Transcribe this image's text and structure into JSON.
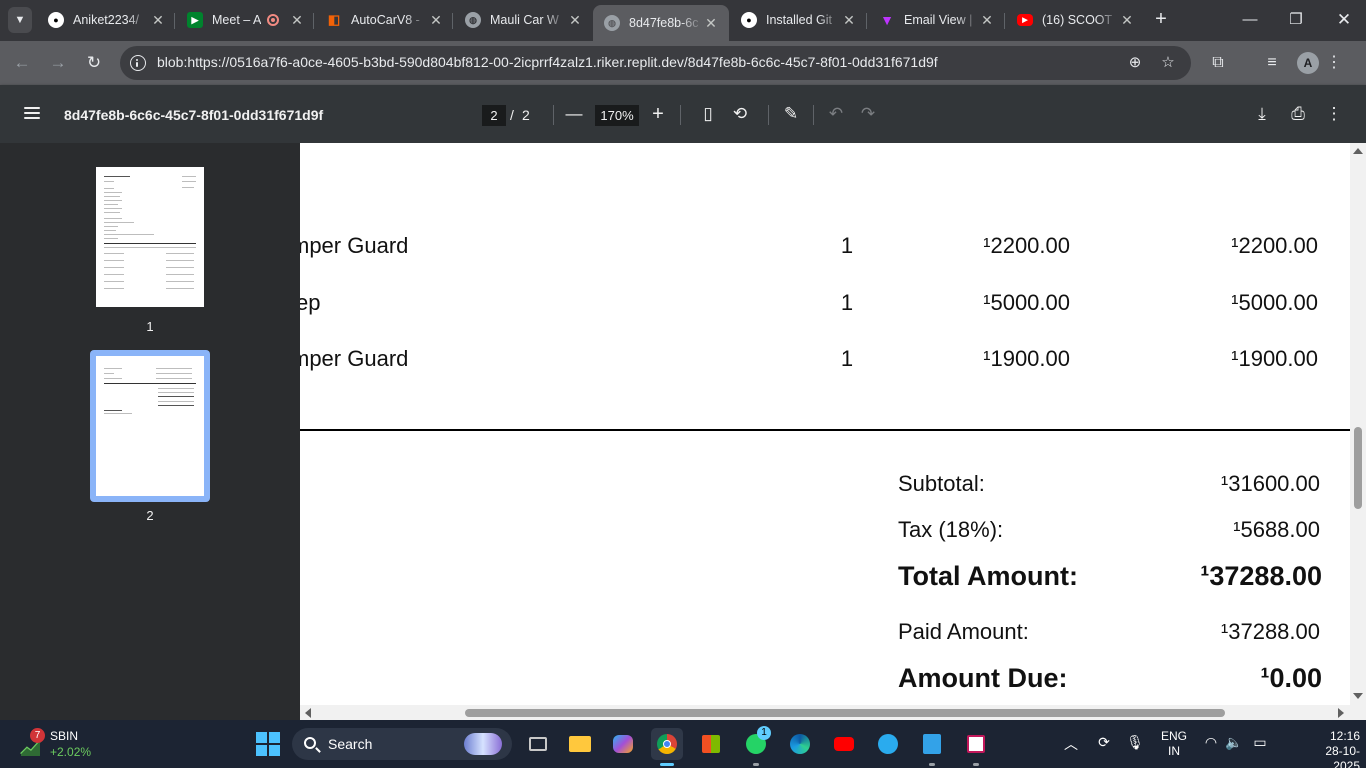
{
  "browser": {
    "tabs": [
      {
        "title": "Aniket2234/",
        "icon": "github-icon"
      },
      {
        "title": "Meet – A",
        "icon": "google-meet-icon"
      },
      {
        "title": "AutoCarV8 -",
        "icon": "replit-icon"
      },
      {
        "title": "Mauli Car W",
        "icon": "globe-icon"
      },
      {
        "title": "8d47fe8b-6c",
        "icon": "globe-icon",
        "active": true
      },
      {
        "title": "Installed Git",
        "icon": "github-icon"
      },
      {
        "title": "Email View |",
        "icon": "vite-icon"
      },
      {
        "title": "(16) SCOOT",
        "icon": "youtube-icon"
      }
    ],
    "url": "blob:https://0516a7f6-a0ce-4605-b3bd-590d804bf812-00-2icprrf4zalz1.riker.replit.dev/8d47fe8b-6c6c-45c7-8f01-0dd31f671d9f",
    "profile_initial": "A"
  },
  "pdf_toolbar": {
    "title": "8d47fe8b-6c6c-45c7-8f01-0dd31f671d9f",
    "current_page": "2",
    "separator": "/",
    "total_pages": "2",
    "zoom": "170%"
  },
  "sidebar": {
    "thumbnails": [
      {
        "number": "1"
      },
      {
        "number": "2",
        "selected": true
      }
    ]
  },
  "invoice": {
    "items": [
      {
        "description": "mper Guard",
        "qty": "1",
        "price": "¹2200.00",
        "amount": "¹2200.00"
      },
      {
        "description": "ep",
        "qty": "1",
        "price": "¹5000.00",
        "amount": "¹5000.00"
      },
      {
        "description": "mper Guard",
        "qty": "1",
        "price": "¹1900.00",
        "amount": "¹1900.00"
      }
    ],
    "totals": {
      "subtotal_label": "Subtotal:",
      "subtotal_value": "¹31600.00",
      "tax_label": "Tax (18%):",
      "tax_value": "¹5688.00",
      "total_label": "Total Amount:",
      "total_value": "¹37288.00",
      "paid_label": "Paid Amount:",
      "paid_value": "¹37288.00",
      "due_label": "Amount Due:",
      "due_value": "¹0.00"
    }
  },
  "taskbar": {
    "stock_badge": "7",
    "stock_name": "SBIN",
    "stock_change": "+2.02%",
    "search_label": "Search",
    "whatsapp_badge": "1",
    "language_line1": "ENG",
    "language_line2": "IN",
    "time": "12:16",
    "date": "28-10-2025"
  },
  "colors": {
    "tabstrip": "#35363a",
    "toolbar": "#5b5c60",
    "pdf_toolbar": "#323639",
    "sidebar": "#2a2c2e",
    "selected_thumbnail": "#8ab4f8",
    "taskbar": "#1c2433",
    "stock_positive": "#6ccb5f"
  }
}
